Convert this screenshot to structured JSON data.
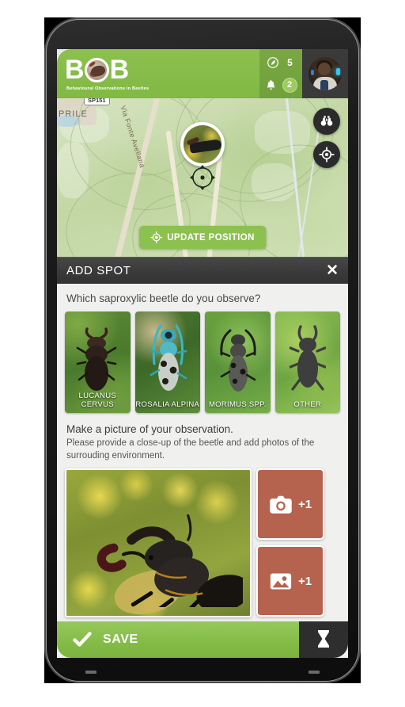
{
  "app": {
    "logo_b1": "B",
    "logo_b2": "B",
    "tagline": "Behavioural Observations in Beetles",
    "brand_green": "#8cc04f",
    "accent_red": "#b5624f",
    "panel_dark": "#3a3a3a"
  },
  "header": {
    "leaf_icon": "leaf-icon",
    "leaf_count": "5",
    "bell_icon": "bell-icon",
    "notification_badge": "2",
    "avatar_icon": "user-avatar"
  },
  "map": {
    "place_label": "PRILE",
    "road_shield": "SP151",
    "street_name": "Via Fonte Avellana",
    "binoculars_icon": "binoculars-icon",
    "locate_icon": "locate-crosshair-icon",
    "spot_marker_icon": "observation-photo-marker",
    "position_target_icon": "position-target-icon",
    "update_button": {
      "icon": "target-icon",
      "label": "UPDATE POSITION"
    }
  },
  "panel": {
    "title": "ADD SPOT",
    "close_icon": "close-icon",
    "close_label": "✕"
  },
  "form": {
    "question": "Which saproxylic beetle do you observe?",
    "species": [
      {
        "label": "LUCANUS CERVUS",
        "icon": "stag-beetle-photo"
      },
      {
        "label": "ROSALIA ALPINA",
        "icon": "rosalia-beetle-photo"
      },
      {
        "label": "MORIMUS SPP.",
        "icon": "morimus-beetle-photo"
      },
      {
        "label": "OTHER",
        "icon": "beetle-silhouette-icon"
      }
    ],
    "instruction_title": "Make a picture of your observation.",
    "instruction_body": "Please provide a close-up of the beetle and add photos of the surrouding environment.",
    "main_photo_icon": "stag-beetle-photo-preview",
    "photo_buttons": [
      {
        "icon": "camera-icon",
        "label": "+1"
      },
      {
        "icon": "gallery-image-icon",
        "label": "+1"
      }
    ]
  },
  "bottom": {
    "save": {
      "icon": "check-icon",
      "label": "SAVE"
    },
    "history": {
      "icon": "hourglass-icon",
      "label": ""
    }
  }
}
